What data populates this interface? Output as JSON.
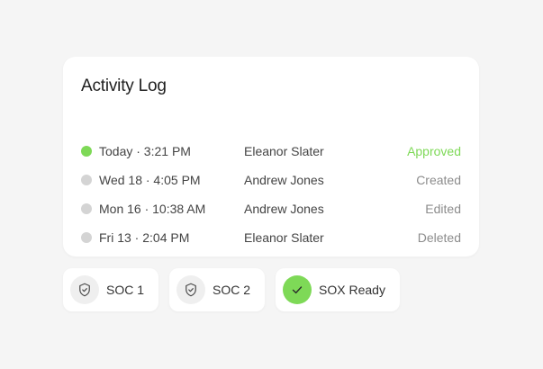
{
  "activity": {
    "title": "Activity Log",
    "rows": [
      {
        "time": "Today · 3:21 PM",
        "user": "Eleanor Slater",
        "status": "Approved",
        "active": true
      },
      {
        "time": "Wed 18 · 4:05 PM",
        "user": "Andrew Jones",
        "status": "Created",
        "active": false
      },
      {
        "time": "Mon 16 · 10:38 AM",
        "user": "Andrew Jones",
        "status": "Edited",
        "active": false
      },
      {
        "time": "Fri 13 · 2:04 PM",
        "user": "Eleanor Slater",
        "status": "Deleted",
        "active": false
      }
    ]
  },
  "badges": [
    {
      "label": "SOC 1",
      "icon": "shield-check-icon"
    },
    {
      "label": "SOC 2",
      "icon": "shield-check-icon"
    },
    {
      "label": "SOX Ready",
      "icon": "checkmark-icon"
    }
  ],
  "colors": {
    "accent": "#7ed957",
    "inactive_dot": "#d4d4d4",
    "background": "#f5f5f5",
    "muted_text": "#8c8c8c"
  }
}
